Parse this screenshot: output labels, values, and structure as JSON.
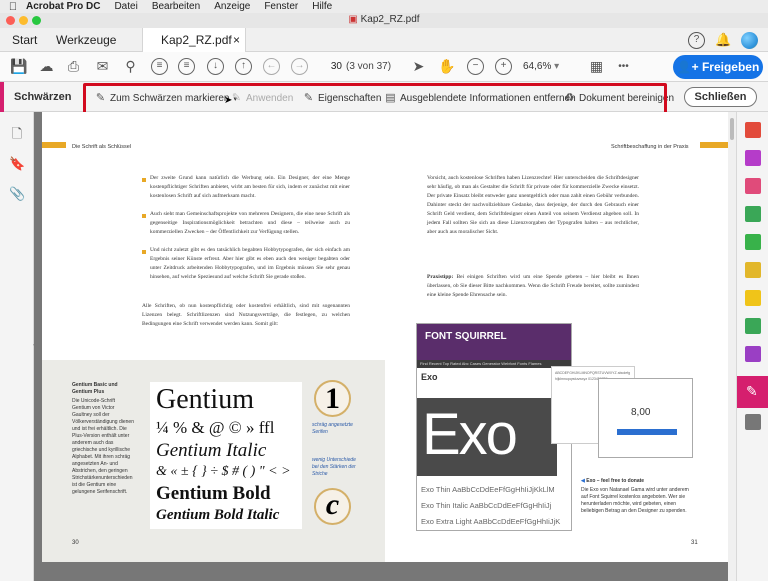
{
  "menubar": {
    "app_name": "Acrobat Pro DC",
    "items": [
      "Datei",
      "Bearbeiten",
      "Anzeige",
      "Fenster",
      "Hilfe"
    ]
  },
  "window": {
    "title": "Kap2_RZ.pdf"
  },
  "tabs": {
    "start": "Start",
    "tools": "Werkzeuge",
    "document": "Kap2_RZ.pdf",
    "close": "×"
  },
  "toolbar": {
    "current_page": "30",
    "page_count": "(3 von 37)",
    "zoom": "64,6%",
    "share_label": "Freigeben",
    "more": "•••"
  },
  "redact_bar": {
    "title": "Schwärzen",
    "mark_label": "Zum Schwärzen markieren",
    "apply_label": "Anwenden",
    "properties_label": "Eigenschaften",
    "hidden_info_label": "Ausgeblendete Informationen entfernen",
    "sanitize_label": "Dokument bereinigen",
    "close_label": "Schließen"
  },
  "doc": {
    "left": {
      "running_head": "Die Schrift als Schlüssel",
      "bullets": [
        "Der zweite Grund kann natürlich die Werbung sein. Ein Designer, der eine Menge kostenpflichtiger Schriften anbietet, wirbt am besten für sich, indem er zunächst mit einer kostenlosen Schrift auf sich aufmerksam macht.",
        "Auch sieht man Gemeinschaftsprojekte von mehreren Designern, die eine neue Schrift als gegenseitige Inspirationsmöglichkeit betrachten und diese – teilweise auch zu kommerziellen Zwecken – der Öffentlichkeit zur Verfügung stellen.",
        "Und nicht zuletzt gibt es den tatsächlich begabten Hobbytypografen, der sich einfach am Ergebnis seiner Künste erfreut. Aber hier gibt es eben auch den weniger begabten oder unter Zeitdruck arbeitenden Hobbytypografen, und im Ergebnis müssen Sie sehr genau hinsehen, auf welche Speziesund auf welche Schrift Sie gerade stoßen."
      ],
      "paragraph": "Alle Schriften, ob nun kostenpflichtig oder kostenfrei erhältlich, sind mit sogenannten Lizenzen belegt. Schriftlizenzen sind Nutzungsverträge, die festlegen, zu welchen Bedingungen eine Schrift verwendet werden kann. Somit gilt:",
      "sidenote_title": "Gentium Basic und Gentium Plus",
      "sidenote_body": "Die Unicode-Schrift Gentium von Victor Gaultney soll der Völkerverständigung dienen und ist frei erhältlich. Die Plus-Version enthält unter anderem auch das griechische und kyrillische Alphabet. Mit ihren schräg angesetzten An- und Abstrichen, den geringen Strichstärkenunterschieden ist die Gentium eine gelungene Serifenschrift.",
      "specimen": [
        "Gentium",
        "¼ % & @ © » ffl",
        "Gentium Italic",
        "& « ± { } ÷ $ # ( ) \" < > ",
        "Gentium Bold",
        "Gentium Bold Italic"
      ],
      "note1": "schräg angesetzte Serifen",
      "note2": "wenig Unterschiede bei den Stärken der Striche",
      "circle1": "1",
      "circle2": "c",
      "page_number": "30"
    },
    "right": {
      "running_head": "Schriftbeschaffung in der Praxis",
      "paragraph1": "Vorsicht, auch kostenlose Schriften haben Lizenzrechte! Hier unterscheiden die Schriftdesigner sehr häufig, ob man als Gestalter die Schrift für private oder für kommerzielle Zwecke einsetzt. Der private Einsatz bleibt entweder ganz unentgeltlich oder man zahlt einen Gebühr verbunden. Dahinter steckt der nachvollziehbare Gedanke, dass derjenige, der durch den Gebrauch einer Schrift Geld verdient, dem Schriftdesigner einen Anteil von seinem Verdienst abgeben soll. In jedem Fall sollten Sie sich an diese Lizenzvorgaben der Typografen halten – aus rechtlicher, aber auch aus moralischer Sicht.",
      "tip_label": "Praxistipp:",
      "tip": " Bei einigen Schriften wird um eine Spende gebeten – hier bleibt es Ihnen überlassen, ob Sie dieser Bitte nachkommen. Wenn die Schrift Freude bereitet, sollte zumindest eine kleine Spende Ehrensache sein.",
      "site_logo": "FONT SQUIRREL",
      "site_nav": "Find  Recent  Top Rated  Abc  Cases  Generator  Webfont Fonts  Flames",
      "site_font": "Exo",
      "exo_big": "Exo",
      "samples": [
        "Exo Thin AaBbCcDdEeFfGgHhIiJjKkLlM",
        "Exo Thin Italic AaBbCcDdEeFfGgHhIiJj",
        "Exo Extra Light AaBbCcDdEeFfGgHhIiJjK"
      ],
      "glyphs": "ABCDEFGHIJKLMNOPQRSTUVWXYZ abcdefghijklmnopqrstuvwxyz 0123456789",
      "donate_amount": "8,00",
      "caption_title": "Exo – feel free to donate",
      "caption_body": "Die Exo von Natanael Gama wird unter anderem auf Font Squirrel kostenlos angeboten. Wer sie herunterladen möchte, wird gebeten, einen beliebigen Betrag an den Designer zu spenden.",
      "page_number": "31"
    }
  },
  "colors": {
    "accent": "#d51f6e",
    "share": "#1473e6",
    "highlight": "#d20a1e",
    "page_accent": "#e8a826"
  },
  "icons": {
    "right_rail": [
      "create-pdf-icon",
      "edit-pdf-icon",
      "export-pdf-icon",
      "combine-icon",
      "organize-icon",
      "enhance-scans-icon",
      "comment-icon",
      "fill-sign-icon",
      "protect-icon",
      "redact-icon",
      "more-tools-icon"
    ]
  }
}
